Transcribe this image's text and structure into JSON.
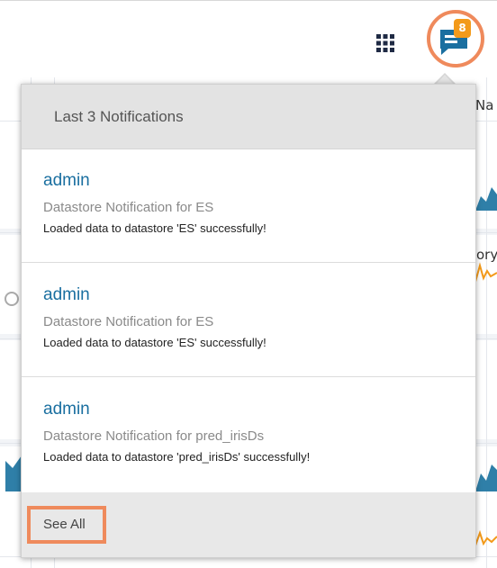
{
  "header": {
    "apps_icon": "grid-apps-icon",
    "notifications_icon": "chat-notification-icon",
    "notification_count": "8",
    "accent_color": "#ef8a5c",
    "badge_color": "#f39a1a"
  },
  "background": {
    "partial_text_top": "Na",
    "partial_text_mid": "ory"
  },
  "notifications": {
    "title": "Last 3 Notifications",
    "items": [
      {
        "user": "admin",
        "subject": "Datastore Notification for ES",
        "message": "Loaded data to datastore 'ES' successfully!"
      },
      {
        "user": "admin",
        "subject": "Datastore Notification for ES",
        "message": "Loaded data to datastore 'ES' successfully!"
      },
      {
        "user": "admin",
        "subject": "Datastore Notification for pred_irisDs",
        "message": "Loaded data to datastore 'pred_irisDs' successfully!"
      }
    ],
    "see_all_label": "See All"
  }
}
